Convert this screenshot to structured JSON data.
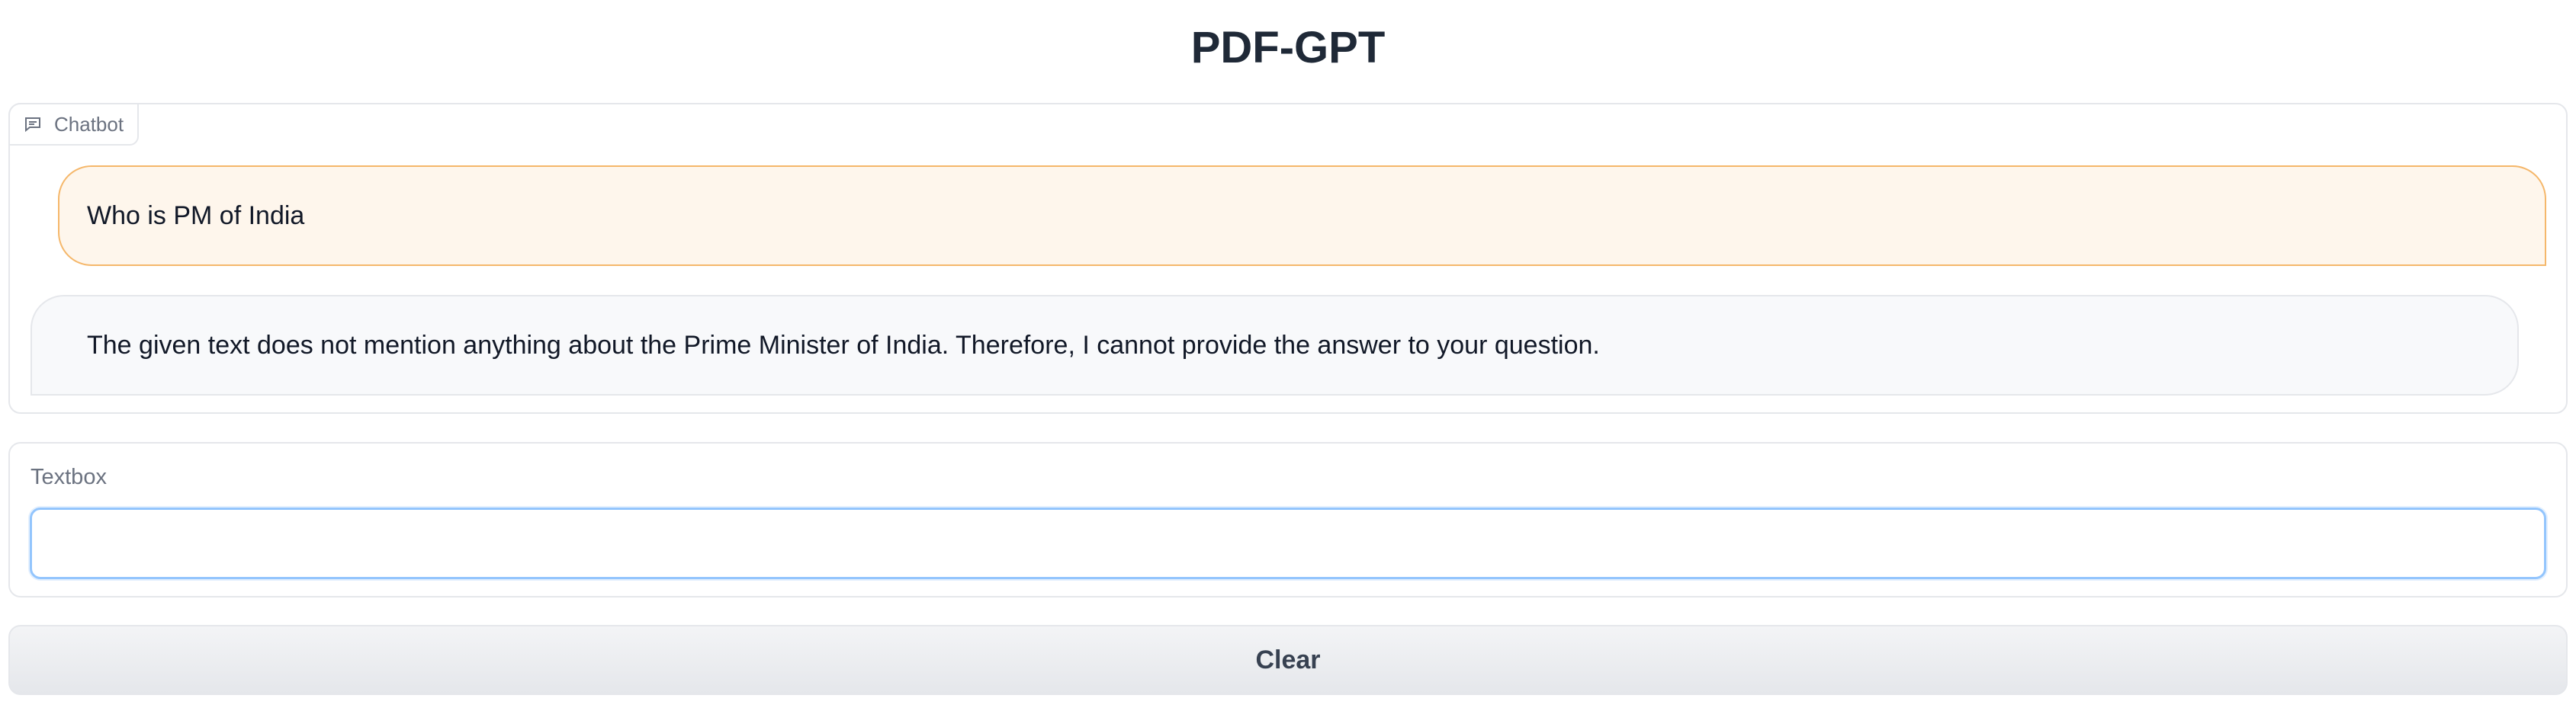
{
  "app": {
    "title": "PDF-GPT"
  },
  "chatbot": {
    "label": "Chatbot",
    "icon": "chat-icon",
    "messages": [
      {
        "role": "user",
        "text": "Who is PM of India"
      },
      {
        "role": "bot",
        "text": "The given text does not mention anything about the Prime Minister of India. Therefore, I cannot provide the answer to your question."
      }
    ]
  },
  "textbox": {
    "label": "Textbox",
    "value": "",
    "placeholder": ""
  },
  "actions": {
    "clear_label": "Clear"
  },
  "colors": {
    "user_bubble_bg": "#fef6ec",
    "user_bubble_border": "#f5b76a",
    "bot_bubble_bg": "#f8f9fb",
    "input_focus_border": "#93c5fd"
  }
}
